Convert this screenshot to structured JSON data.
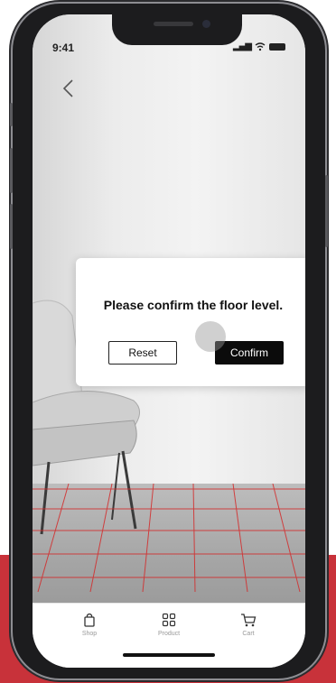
{
  "status_bar": {
    "time": "9:41"
  },
  "dialog": {
    "title": "Please confirm the floor level.",
    "reset_label": "Reset",
    "confirm_label": "Confirm"
  },
  "tabs": [
    {
      "label": "Shop",
      "icon": "shopping-bag-icon"
    },
    {
      "label": "Product",
      "icon": "grid-icon"
    },
    {
      "label": "Cart",
      "icon": "cart-icon"
    }
  ],
  "colors": {
    "accent_red": "#c8323a",
    "grid_red": "#d42a2a",
    "confirm_bg": "#0b0b0b"
  }
}
